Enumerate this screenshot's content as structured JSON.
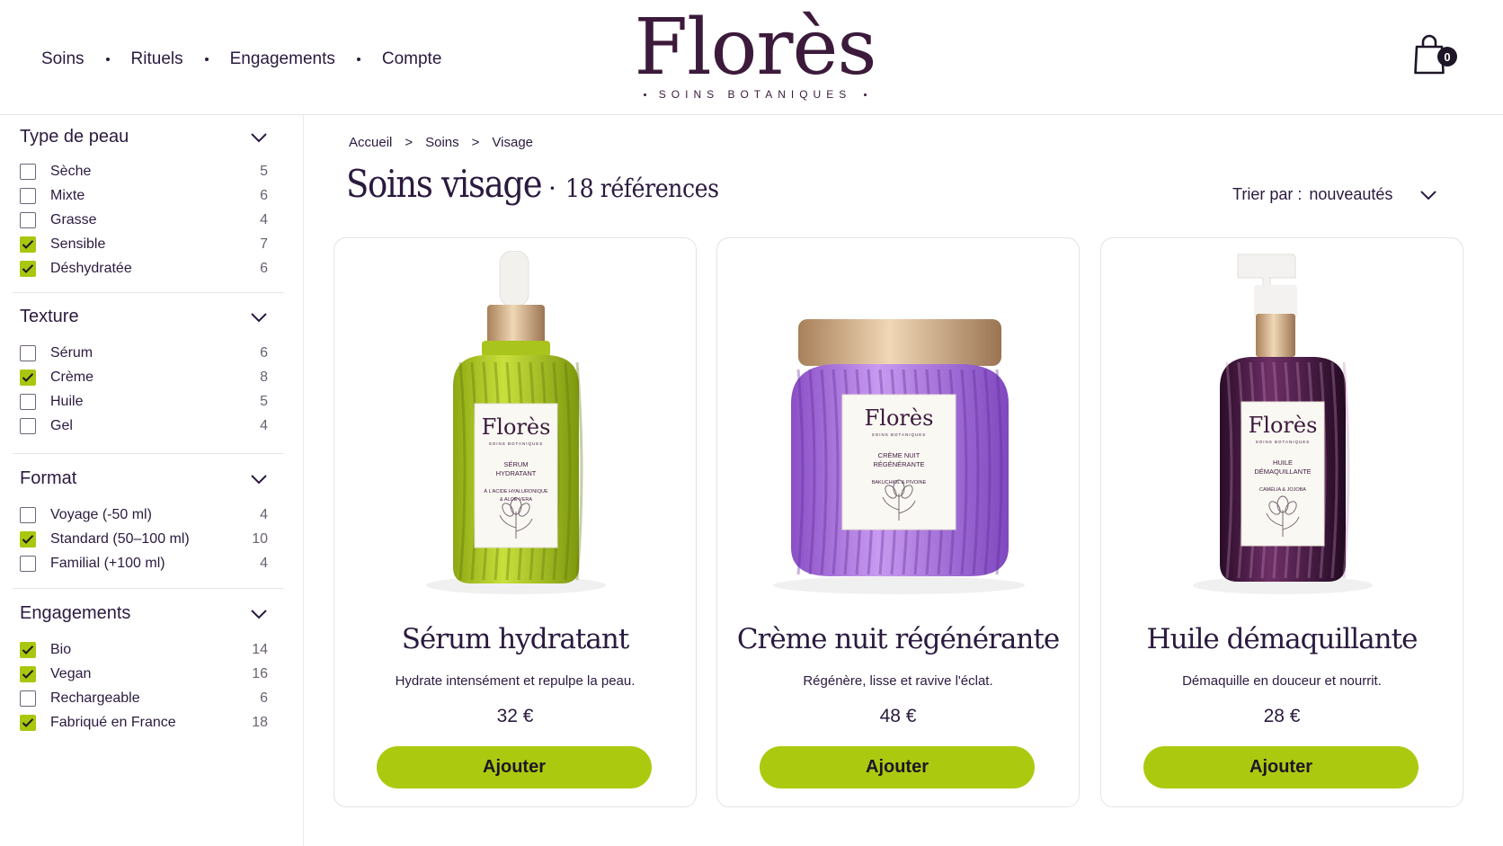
{
  "header": {
    "nav": [
      "Soins",
      "Rituels",
      "Engagements",
      "Compte"
    ],
    "logo": "Florès",
    "logo_tagline": "SOINS BOTANIQUES",
    "cart_count": "0"
  },
  "filters": [
    {
      "title": "Type de peau",
      "options": [
        {
          "label": "Sèche",
          "count": "5",
          "checked": false
        },
        {
          "label": "Mixte",
          "count": "6",
          "checked": false
        },
        {
          "label": "Grasse",
          "count": "4",
          "checked": false
        },
        {
          "label": "Sensible",
          "count": "7",
          "checked": true
        },
        {
          "label": "Déshydratée",
          "count": "6",
          "checked": true
        }
      ]
    },
    {
      "title": "Texture",
      "options": [
        {
          "label": "Sérum",
          "count": "6",
          "checked": false
        },
        {
          "label": "Crème",
          "count": "8",
          "checked": true
        },
        {
          "label": "Huile",
          "count": "5",
          "checked": false
        },
        {
          "label": "Gel",
          "count": "4",
          "checked": false
        }
      ]
    },
    {
      "title": "Format",
      "options": [
        {
          "label": "Voyage (-50 ml)",
          "count": "4",
          "checked": false
        },
        {
          "label": "Standard (50–100 ml)",
          "count": "10",
          "checked": true
        },
        {
          "label": "Familial (+100 ml)",
          "count": "4",
          "checked": false
        }
      ]
    },
    {
      "title": "Engagements",
      "options": [
        {
          "label": "Bio",
          "count": "14",
          "checked": true
        },
        {
          "label": "Vegan",
          "count": "16",
          "checked": true
        },
        {
          "label": "Rechargeable",
          "count": "6",
          "checked": false
        },
        {
          "label": "Fabriqué en France",
          "count": "18",
          "checked": true
        }
      ]
    }
  ],
  "breadcrumb": [
    "Accueil",
    "Soins",
    "Visage"
  ],
  "breadcrumb_sep": ">",
  "page": {
    "title": "Soins visage",
    "separator": "·",
    "count": "18 références"
  },
  "sort": {
    "label": "Trier par :",
    "value": "nouveautés"
  },
  "products": [
    {
      "name": "Sérum hydratant",
      "description": "Hydrate intensément et repulpe la peau.",
      "price": "32 €",
      "button": "Ajouter",
      "label_brand": "Florès",
      "label_tag": "SOINS BOTANIQUES",
      "label_line1": "SÉRUM",
      "label_line2": "HYDRATANT",
      "label_line3": "À L'ACIDE HYALURONIQUE",
      "label_line4": "& ALOE VERA",
      "color": "#a9c41c"
    },
    {
      "name": "Crème nuit régénérante",
      "description": "Régénère, lisse et ravive l'éclat.",
      "price": "48 €",
      "button": "Ajouter",
      "label_brand": "Florès",
      "label_tag": "SOINS BOTANIQUES",
      "label_line1": "CRÈME NUIT",
      "label_line2": "RÉGÉNÉRANTE",
      "label_line3": "BAKUCHIOL & PIVOINE",
      "label_line4": "",
      "color": "#a874d8"
    },
    {
      "name": "Huile démaquillante",
      "description": "Démaquille en douceur et nourrit.",
      "price": "28 €",
      "button": "Ajouter",
      "label_brand": "Florès",
      "label_tag": "SOINS BOTANIQUES",
      "label_line1": "HUILE",
      "label_line2": "DÉMAQUILLANTE",
      "label_line3": "CAMÉLIA & JOJOBA",
      "label_line4": "",
      "color": "#4a1b45"
    }
  ],
  "colors": {
    "accent": "#abca0f",
    "brand": "#3c1a3b",
    "text": "#2b1a3f"
  }
}
